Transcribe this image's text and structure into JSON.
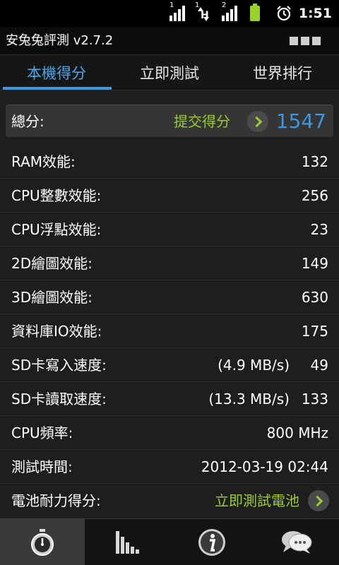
{
  "status": {
    "sim1_label": "1",
    "sim2_label": "1",
    "data_label": "H",
    "sim3_label": "2",
    "time": "1:51"
  },
  "app": {
    "title": "安兔兔評測 v2.7.2"
  },
  "tabs": [
    {
      "label": "本機得分"
    },
    {
      "label": "立即測試"
    },
    {
      "label": "世界排行"
    }
  ],
  "total": {
    "label": "總分:",
    "submit_label": "提交得分",
    "value": "1547"
  },
  "rows": [
    {
      "label": "RAM效能:",
      "value": "132"
    },
    {
      "label": "CPU整數效能:",
      "value": "256"
    },
    {
      "label": "CPU浮點效能:",
      "value": "23"
    },
    {
      "label": "2D繪圖效能:",
      "value": "149"
    },
    {
      "label": "3D繪圖效能:",
      "value": "630"
    },
    {
      "label": "資料庫IO效能:",
      "value": "175"
    },
    {
      "label": "SD卡寫入速度:",
      "speed": "(4.9 MB/s)",
      "value": "49"
    },
    {
      "label": "SD卡讀取速度:",
      "speed": "(13.3 MB/s)",
      "value": "133"
    },
    {
      "label": "CPU頻率:",
      "value": "800 MHz"
    },
    {
      "label": "測試時間:",
      "value": "2012-03-19 02:44"
    },
    {
      "label": "電池耐力得分:",
      "action": "立即測試電池"
    }
  ],
  "bottom_nav": [
    {
      "icon": "stopwatch-icon"
    },
    {
      "icon": "bar-chart-icon"
    },
    {
      "icon": "info-icon"
    },
    {
      "icon": "chat-bubble-icon"
    }
  ],
  "colors": {
    "accent_blue": "#3d97e0",
    "accent_green": "#9acd32",
    "background": "#1e1e1e"
  }
}
